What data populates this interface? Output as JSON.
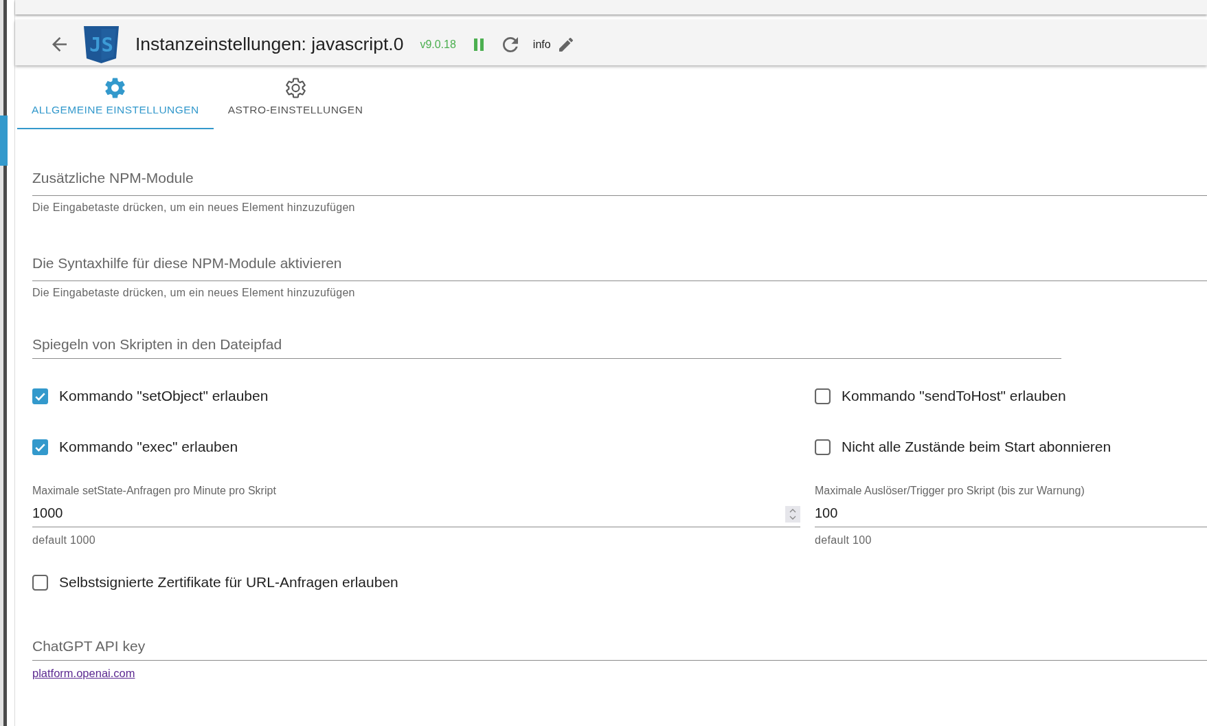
{
  "header": {
    "logo_text": "JS",
    "title": "Instanzeinstellungen: javascript.0",
    "version": "v9.0.18",
    "running": true,
    "info": "info"
  },
  "tabs": [
    {
      "label": "ALLGEMEINE EINSTELLUNGEN",
      "selected": true
    },
    {
      "label": "ASTRO-EINSTELLUNGEN",
      "selected": false
    }
  ],
  "settings": [
    {
      "kind": "chips",
      "placeholder": "Zusätzliche NPM-Module",
      "helper": "Die Eingabetaste drücken, um ein neues Element hinzuzufügen"
    },
    {
      "kind": "chips",
      "placeholder": "Die Syntaxhilfe für diese NPM-Module aktivieren",
      "helper": "Die Eingabetaste drücken, um ein neues Element hinzuzufügen"
    },
    {
      "kind": "path",
      "placeholder": "Spiegeln von Skripten in den Dateipfad"
    },
    {
      "kind": "columns",
      "cells": [
        {
          "kind": "checkbox",
          "label": "Kommando \"setObject\" erlauben",
          "checked": true
        },
        {
          "kind": "checkbox",
          "label": "Kommando \"sendToHost\" erlauben",
          "checked": false
        }
      ]
    },
    {
      "kind": "columns",
      "cells": [
        {
          "kind": "checkbox",
          "label": "Kommando \"exec\" erlauben",
          "checked": true
        },
        {
          "kind": "checkbox",
          "label": "Nicht alle Zustände beim Start abonnieren",
          "checked": false
        }
      ]
    },
    {
      "kind": "columns",
      "cells": [
        {
          "kind": "number",
          "label": "Maximale setState-Anfragen pro Minute pro Skript",
          "value": "1000",
          "helper": "default 1000",
          "hovered": true
        },
        {
          "kind": "number",
          "label": "Maximale Auslöser/Trigger pro Skript (bis zur Warnung)",
          "value": "100",
          "helper": "default 100",
          "hovered": false
        }
      ]
    },
    {
      "kind": "checkbox",
      "label": "Selbstsignierte Zertifikate für URL-Anfragen erlauben",
      "checked": false
    },
    {
      "kind": "secret",
      "placeholder": "ChatGPT API key",
      "link": "platform.openai.com"
    }
  ]
}
